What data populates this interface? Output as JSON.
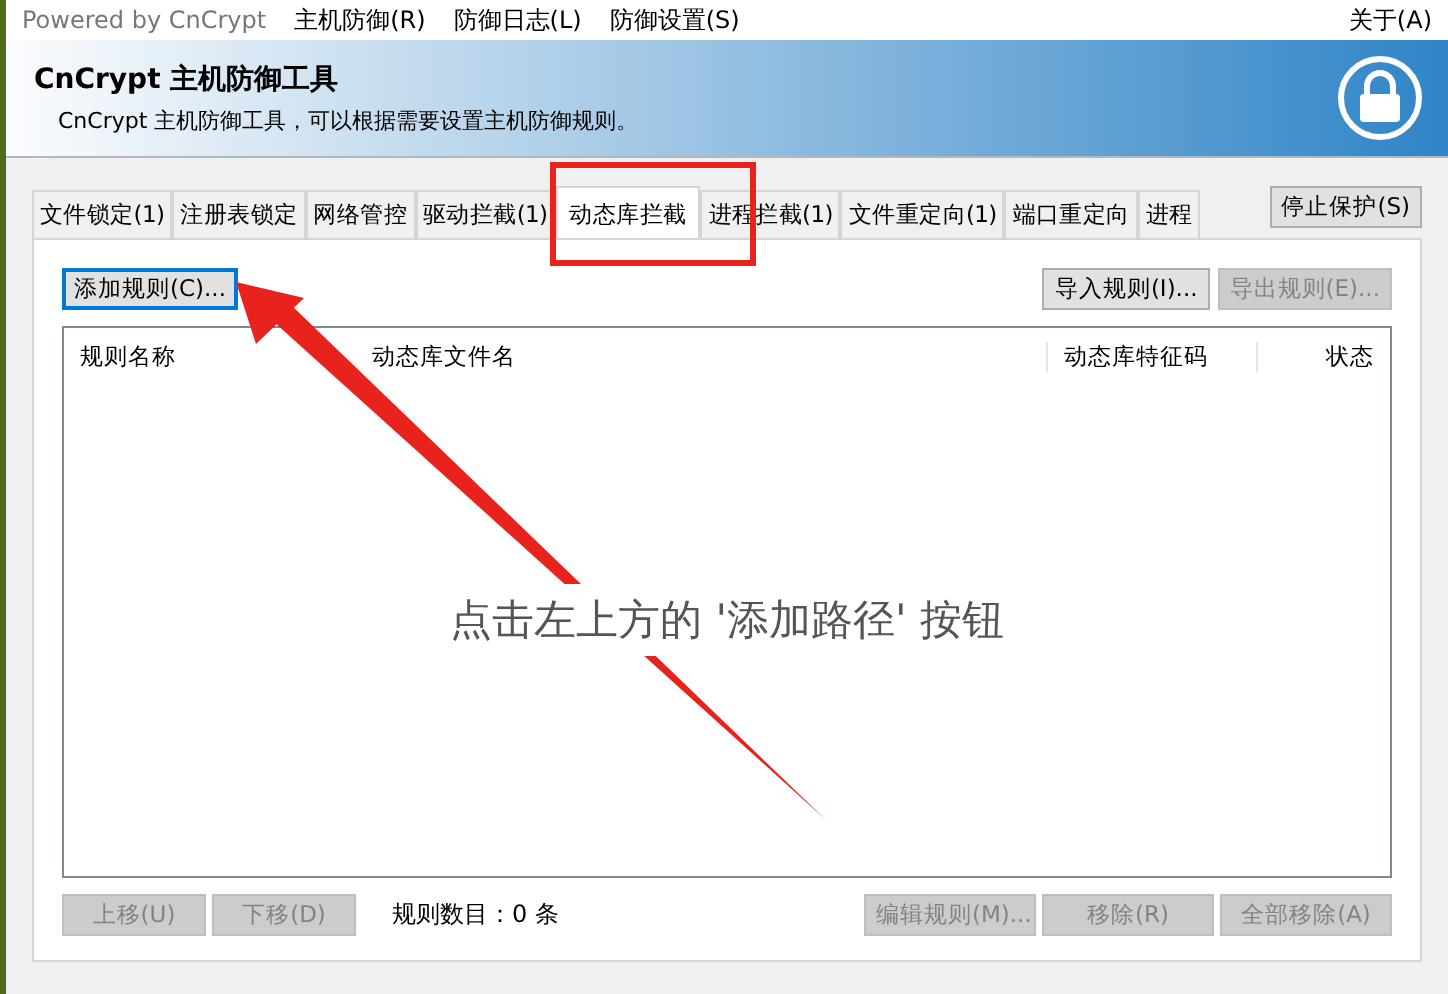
{
  "menu_bar": {
    "brand": "Powered by CnCrypt",
    "items": [
      {
        "label": "主机防御(R)"
      },
      {
        "label": "防御日志(L)"
      },
      {
        "label": "防御设置(S)"
      }
    ],
    "about": "关于(A)"
  },
  "header": {
    "title": "CnCrypt 主机防御工具",
    "subtitle": "CnCrypt 主机防御工具，可以根据需要设置主机防御规则。"
  },
  "tabs": [
    {
      "label": "文件锁定(1)",
      "selected": false
    },
    {
      "label": "注册表锁定",
      "selected": false
    },
    {
      "label": "网络管控",
      "selected": false
    },
    {
      "label": "驱动拦截(1)",
      "selected": false
    },
    {
      "label": "动态库拦截",
      "selected": true
    },
    {
      "label": "进程拦截(1)",
      "selected": false
    },
    {
      "label": "文件重定向(1)",
      "selected": false
    },
    {
      "label": "端口重定向",
      "selected": false
    },
    {
      "label": "进程",
      "selected": false
    }
  ],
  "stop_button": {
    "label": "停止保护(S)"
  },
  "top_buttons": [
    {
      "label": "添加规则(C)...",
      "disabled": false,
      "focused": true
    },
    {
      "label": "导入规则(I)...",
      "disabled": false,
      "focused": false
    },
    {
      "label": "导出规则(E)...",
      "disabled": true,
      "focused": false
    }
  ],
  "table": {
    "columns": [
      "规则名称",
      "动态库文件名",
      "动态库特征码",
      "状态"
    ],
    "empty_message": "点击左上方的 '添加路径' 按钮"
  },
  "bottom_left_buttons": [
    {
      "label": "上移(U)",
      "disabled": true
    },
    {
      "label": "下移(D)",
      "disabled": true
    }
  ],
  "rule_count": "规则数目：0 条",
  "bottom_right_buttons": [
    {
      "label": "编辑规则(M)...",
      "disabled": true
    },
    {
      "label": "移除(R)",
      "disabled": true
    },
    {
      "label": "全部移除(A)",
      "disabled": true
    }
  ]
}
